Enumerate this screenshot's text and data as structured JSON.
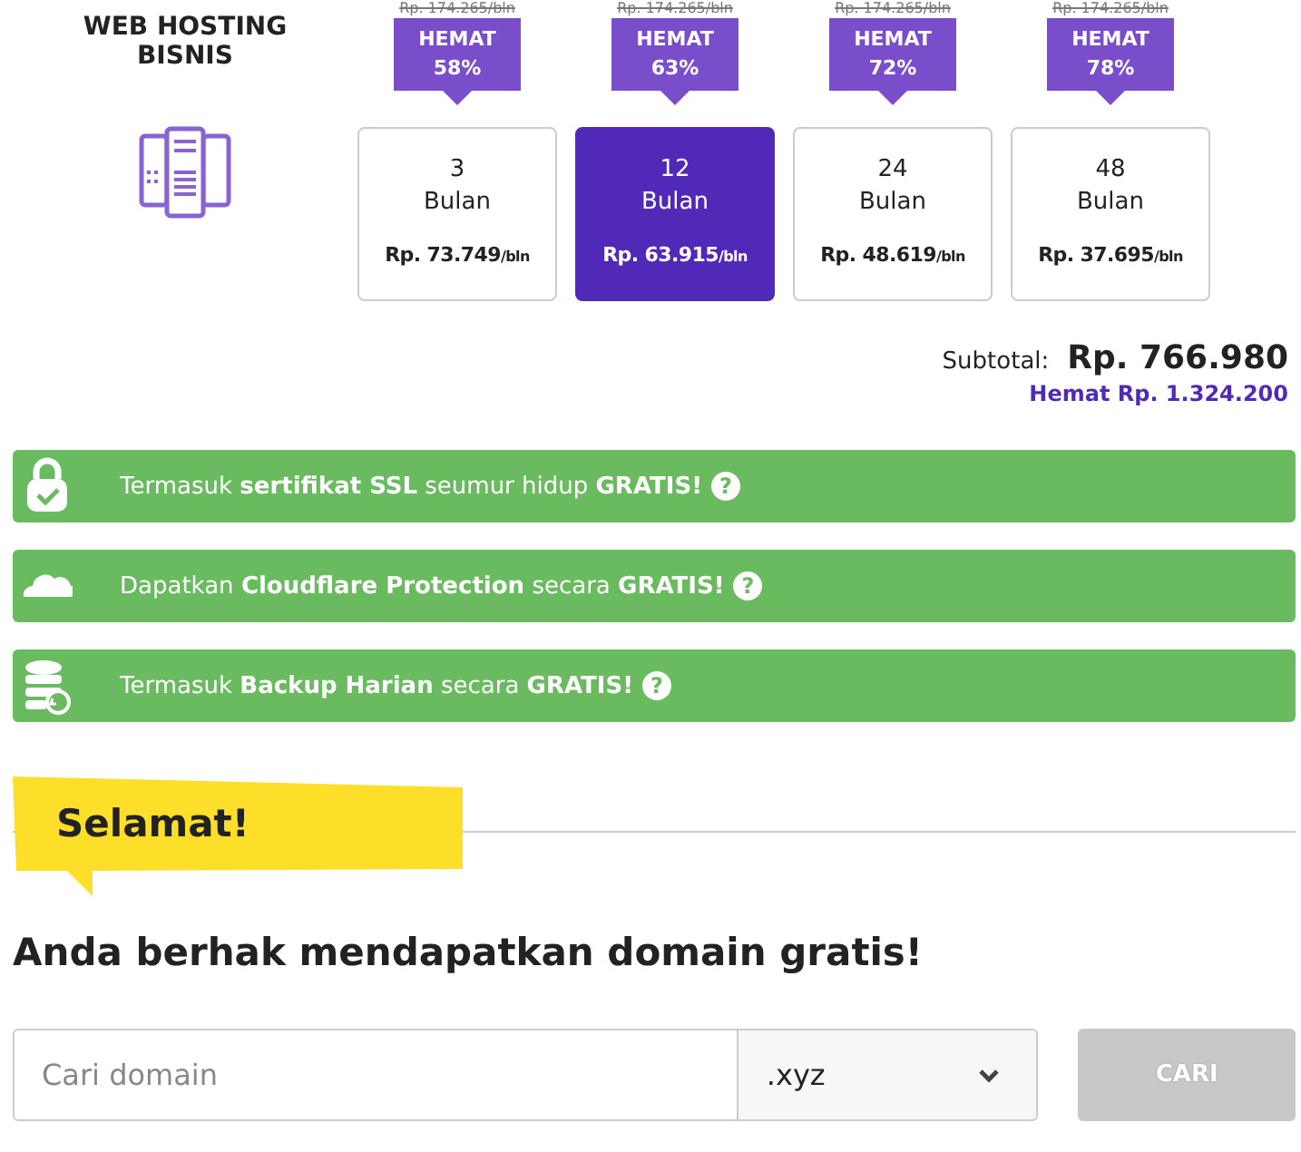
{
  "product": {
    "title": "WEB HOSTING BISNIS"
  },
  "plans": [
    {
      "old_price": "Rp. 174.265/bln",
      "badge": "HEMAT",
      "discount": "58%",
      "months": "3",
      "unit": "Bulan",
      "price": "Rp. 73.749",
      "per": "/bln",
      "selected": false
    },
    {
      "old_price": "Rp. 174.265/bln",
      "badge": "HEMAT",
      "discount": "63%",
      "months": "12",
      "unit": "Bulan",
      "price": "Rp. 63.915",
      "per": "/bln",
      "selected": true
    },
    {
      "old_price": "Rp. 174.265/bln",
      "badge": "HEMAT",
      "discount": "72%",
      "months": "24",
      "unit": "Bulan",
      "price": "Rp. 48.619",
      "per": "/bln",
      "selected": false
    },
    {
      "old_price": "Rp. 174.265/bln",
      "badge": "HEMAT",
      "discount": "78%",
      "months": "48",
      "unit": "Bulan",
      "price": "Rp. 37.695",
      "per": "/bln",
      "selected": false
    }
  ],
  "subtotal": {
    "label": "Subtotal:",
    "value": "Rp. 766.980",
    "savings": "Hemat Rp. 1.324.200"
  },
  "features": [
    {
      "kind": "lock",
      "text": "Termasuk **sertifikat SSL** seumur hidup **GRATIS!**",
      "help": "?"
    },
    {
      "kind": "cloud",
      "text": "Dapatkan **Cloudflare Protection** secara **GRATIS!**",
      "help": "?"
    },
    {
      "kind": "backup",
      "text": "Termasuk **Backup Harian** secara **GRATIS!**",
      "help": "?"
    }
  ],
  "domain": {
    "ribbon": "Selamat!",
    "heading": "Anda berhak mendapatkan domain gratis!",
    "search": {
      "placeholder": "Cari domain"
    },
    "tld": ".xyz",
    "button": "CARI",
    "button_disabled": true
  }
}
